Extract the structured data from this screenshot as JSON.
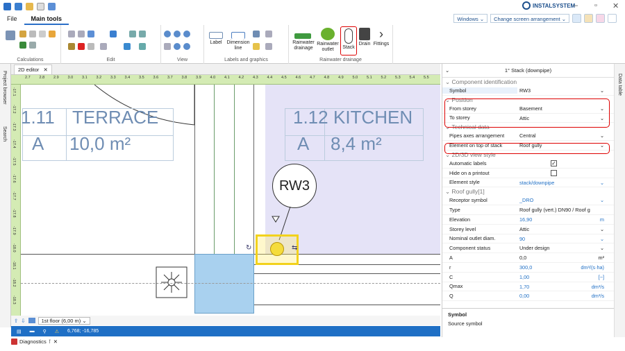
{
  "app": {
    "brand": "INSTALSYSTEM"
  },
  "menu": {
    "file": "File",
    "main_tools": "Main tools"
  },
  "right_controls": {
    "windows": "Windows",
    "arrangement": "Change screen arrangement"
  },
  "ribbon": {
    "groups": [
      "Calculations",
      "Edit",
      "View",
      "Labels and graphics",
      "Rainwater drainage"
    ],
    "buttons": {
      "label": "Label",
      "dimension_line": "Dimension line",
      "rainwater_drainage": "Rainwater drainage",
      "rainwater_outlet": "Rainwater outlet",
      "stack": "Stack",
      "drain": "Drain",
      "fittings": "Fittings"
    }
  },
  "sidebar": {
    "project_browser": "Project browser",
    "search": "Search"
  },
  "editor": {
    "tab": "2D editor",
    "ruler_top": [
      "2.7",
      "2.8",
      "2.9",
      "3.0",
      "3.1",
      "3.2",
      "3.3",
      "3.4",
      "3.5",
      "3.6",
      "3.7",
      "3.8",
      "3.9",
      "4.0",
      "4.1",
      "4.2",
      "4.3",
      "4.4",
      "4.5",
      "4.6",
      "4.7",
      "4.8",
      "4.9",
      "5.0",
      "5.1",
      "5.2",
      "5.3",
      "5.4",
      "5.5"
    ],
    "ruler_left": [
      "-17.1",
      "-17.2",
      "-17.3",
      "-17.4",
      "-17.5",
      "-17.6",
      "-17.7",
      "-17.8",
      "-17.9",
      "-18.0",
      "-18.1",
      "-18.2",
      "-18.3"
    ],
    "rooms": [
      {
        "number": "1.11",
        "name": "TERRACE",
        "letter": "A",
        "area": "10,0 m²"
      },
      {
        "number": "1.12",
        "name": "KITCHEN",
        "letter": "A",
        "area": "8,4 m²"
      }
    ],
    "callout": "RW3",
    "floor": "1st floor (6,00 m)",
    "coordinates": "6,768; -16,785"
  },
  "bottom": {
    "diagnostics": "Diagnostics"
  },
  "panel": {
    "title": "1° Stack (downpipe)",
    "data_table": "Data table",
    "sections": {
      "component": "Component identification",
      "position": "Position",
      "technical": "Technical data",
      "view_style": "2D/3D view style",
      "roof": "Roof gully[1]"
    },
    "rows": {
      "symbol": {
        "k": "Symbol",
        "v": "RW3"
      },
      "from_storey": {
        "k": "From storey",
        "v": "Basement"
      },
      "to_storey": {
        "k": "To storey",
        "v": "Attic"
      },
      "pipes_axes": {
        "k": "Pipes axes arrangement",
        "v": "Central"
      },
      "element_top": {
        "k": "Element on top of stack",
        "v": "Roof gully"
      },
      "auto_labels": {
        "k": "Automatic labels",
        "v": ""
      },
      "hide_print": {
        "k": "Hide on a printout",
        "v": ""
      },
      "element_style": {
        "k": "Element style",
        "v": "stack/downpipe"
      },
      "receptor": {
        "k": "Receptor symbol",
        "v": "_DRO"
      },
      "type": {
        "k": "Type",
        "v": "Roof gully (vert.) DN90 / Roof g"
      },
      "elevation": {
        "k": "Elevation",
        "v": "16,90",
        "u": "m"
      },
      "storey_level": {
        "k": "Storey level",
        "v": "Attic"
      },
      "nominal": {
        "k": "Nominal outlet diam.",
        "v": "90"
      },
      "status": {
        "k": "Component status",
        "v": "Under design"
      },
      "a": {
        "k": "A",
        "v": "0,0",
        "u": "m²"
      },
      "r": {
        "k": "r",
        "v": "300,0",
        "u": "dm³/(s·ha)"
      },
      "c": {
        "k": "C",
        "v": "1,00",
        "u": "[−]"
      },
      "qmax": {
        "k": "Qmax",
        "v": "1,70",
        "u": "dm³/s"
      },
      "q": {
        "k": "Q",
        "v": "0,00",
        "u": "dm³/s"
      }
    },
    "footer": {
      "title": "Symbol",
      "desc": "Source symbol"
    }
  }
}
